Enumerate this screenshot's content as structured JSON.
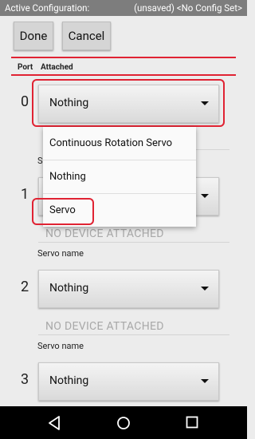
{
  "status_bar": {
    "left_label": "Active Configuration:",
    "right_label": "(unsaved) <No Config Set>"
  },
  "toolbar": {
    "done_label": "Done",
    "cancel_label": "Cancel"
  },
  "table_header": {
    "port": "Port",
    "attached": "Attached"
  },
  "ports": [
    {
      "port": "0",
      "selected": "Nothing"
    },
    {
      "port": "1",
      "selected": "",
      "no_device": "NO DEVICE ATTACHED",
      "name_label": "Servo name"
    },
    {
      "port": "2",
      "selected": "Nothing",
      "no_device": "NO DEVICE ATTACHED",
      "name_label": "Servo name"
    },
    {
      "port": "3",
      "selected": "Nothing"
    }
  ],
  "dropdown": {
    "options": [
      "Continuous Rotation Servo",
      "Nothing",
      "Servo"
    ],
    "partial_label_behind": "Serv"
  },
  "nav": {
    "icons": [
      "back-icon",
      "home-icon",
      "recent-apps-icon"
    ]
  },
  "colors": {
    "highlight": "#e02333",
    "status_bar": "#7d7d7d",
    "background": "#ececec",
    "nav_bar": "#000000"
  }
}
